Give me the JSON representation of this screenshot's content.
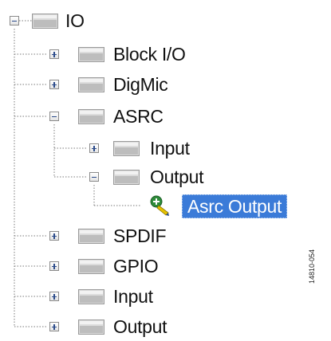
{
  "tree": {
    "root": {
      "label": "IO",
      "icon": "folder-icon",
      "expanded": true
    },
    "children": [
      {
        "label": "Block I/O",
        "icon": "folder-icon",
        "expanded": false
      },
      {
        "label": "DigMic",
        "icon": "folder-icon",
        "expanded": false
      },
      {
        "label": "ASRC",
        "icon": "folder-icon",
        "expanded": true,
        "children": [
          {
            "label": "Input",
            "icon": "folder-icon",
            "expanded": false
          },
          {
            "label": "Output",
            "icon": "folder-icon",
            "expanded": true,
            "children": [
              {
                "label": "Asrc Output",
                "icon": "green-arrow-node-icon",
                "selected": true
              }
            ]
          }
        ]
      },
      {
        "label": "SPDIF",
        "icon": "folder-icon",
        "expanded": false
      },
      {
        "label": "GPIO",
        "icon": "folder-icon",
        "expanded": false
      },
      {
        "label": "Input",
        "icon": "folder-icon",
        "expanded": false
      },
      {
        "label": "Output",
        "icon": "folder-icon",
        "expanded": false
      }
    ]
  },
  "figure_code": "14810-054",
  "colors": {
    "selection": "#3b7bd8",
    "expander_glyph": "#2a4a8a",
    "connector": "#7a7a7a",
    "folder": "#c9c9c9",
    "action_green": "#2e8b3a",
    "action_yellow": "#e6c200"
  }
}
